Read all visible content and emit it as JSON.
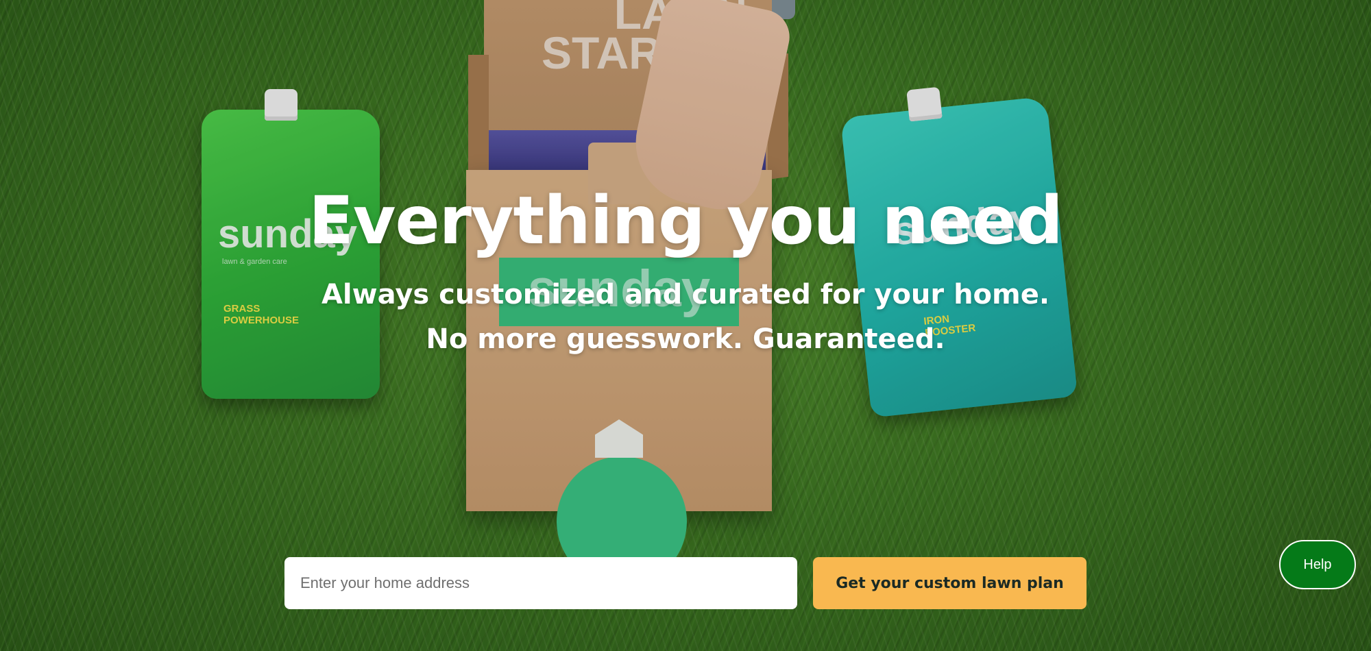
{
  "hero": {
    "headline": "Everything you need",
    "subhead_line1": "Always customized and curated for your home.",
    "subhead_line2": "No more guesswork. Guaranteed."
  },
  "address_form": {
    "placeholder": "Enter your home address",
    "value": "",
    "submit_label": "Get your custom lawn plan"
  },
  "help": {
    "label": "Help"
  },
  "background_photo": {
    "box_lid_text": "LAWN STARTER KIT",
    "brand": "sunday",
    "left_pouch_brand": "sunday",
    "left_pouch_tagline": "lawn & garden care",
    "left_pouch_lines": [
      "GRASS",
      "POWERHOUSE"
    ],
    "right_pouch_brand": "sunday",
    "right_pouch_lines": [
      "IRON",
      "BOOSTER"
    ]
  },
  "colors": {
    "cta_background": "#f9b850",
    "cta_text": "#1b2a24",
    "help_background": "#057a18",
    "headline_text": "#ffffff"
  }
}
